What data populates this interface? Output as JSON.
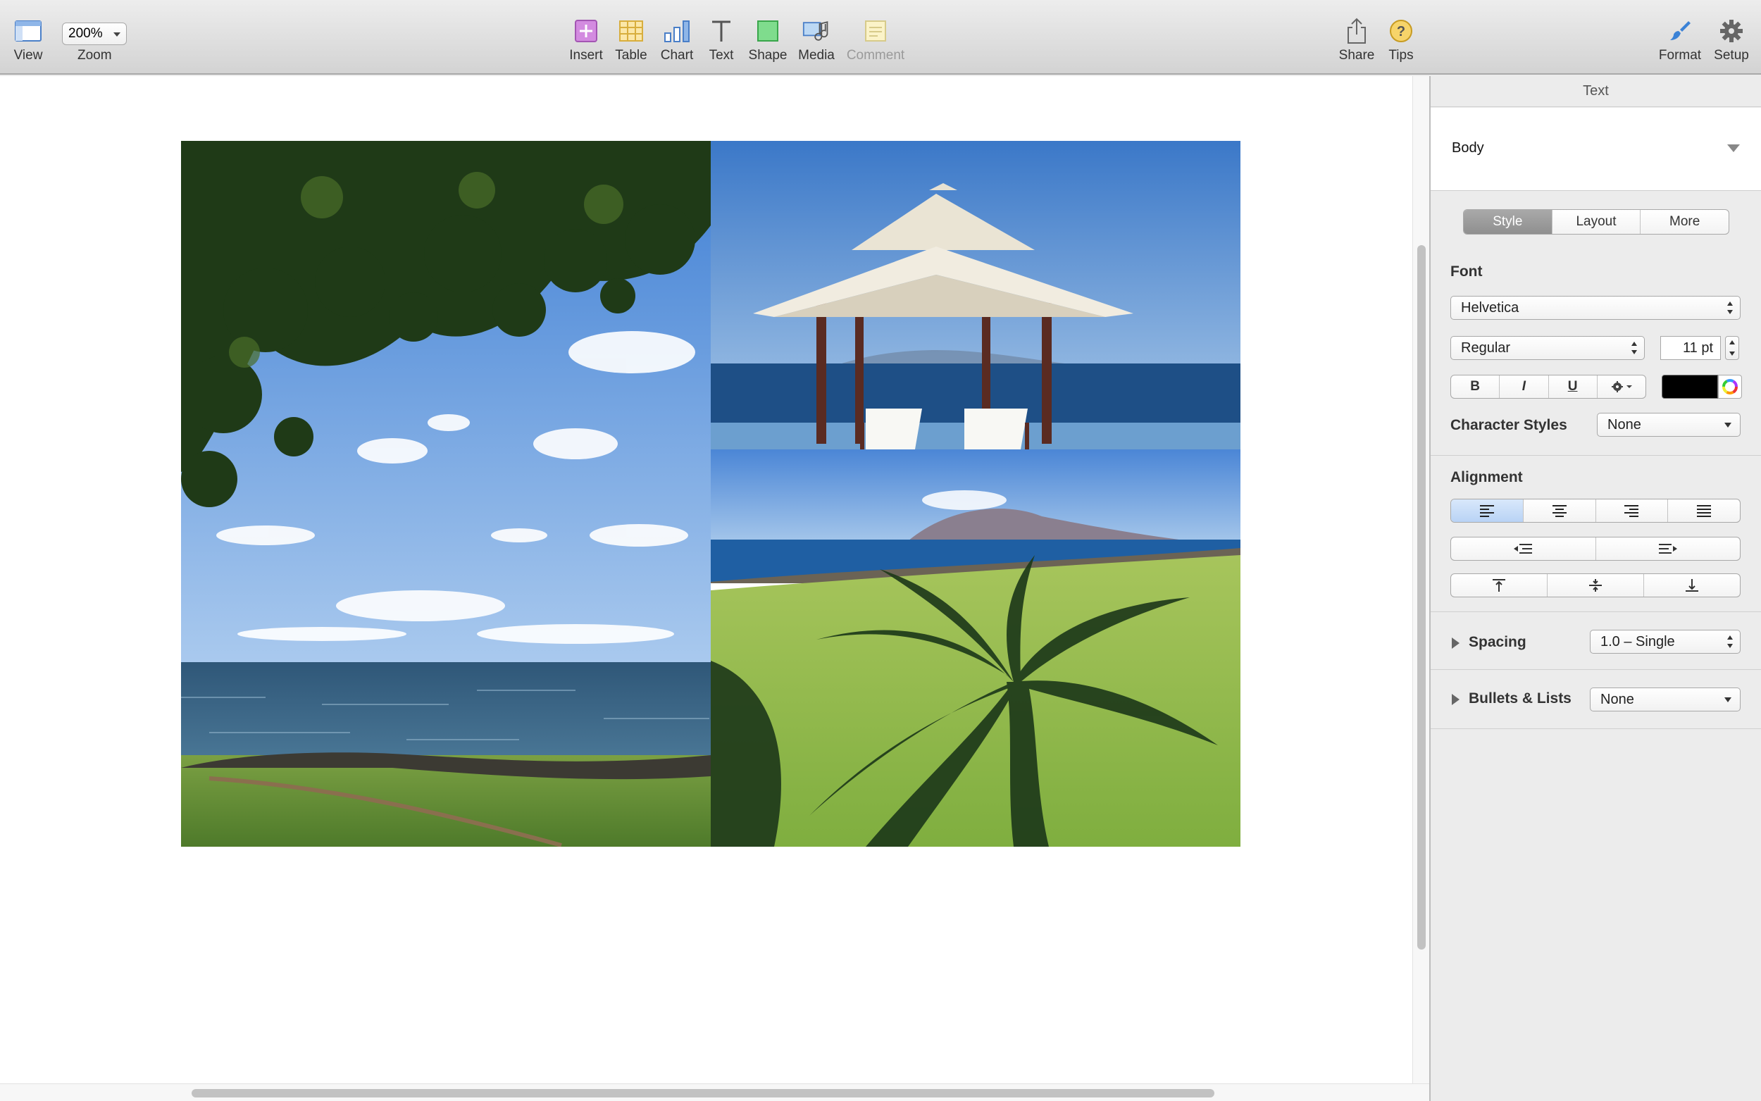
{
  "toolbar": {
    "view_label": "View",
    "zoom_value": "200%",
    "zoom_label": "Zoom",
    "insert_label": "Insert",
    "table_label": "Table",
    "chart_label": "Chart",
    "text_label": "Text",
    "shape_label": "Shape",
    "media_label": "Media",
    "comment_label": "Comment",
    "share_label": "Share",
    "tips_label": "Tips",
    "format_label": "Format",
    "setup_label": "Setup"
  },
  "sidebar": {
    "header": "Text",
    "paragraph_style": "Body",
    "tabs": [
      "Style",
      "Layout",
      "More"
    ],
    "font_title": "Font",
    "font_family": "Helvetica",
    "font_typeface": "Regular",
    "font_size": "11 pt",
    "bold": "B",
    "italic": "I",
    "underline": "U",
    "text_color": "#000000",
    "character_styles_title": "Character Styles",
    "character_styles_value": "None",
    "alignment_title": "Alignment",
    "spacing_title": "Spacing",
    "spacing_value": "1.0 – Single",
    "bullets_title": "Bullets & Lists",
    "bullets_value": "None"
  },
  "colors": {
    "accent_blue": "#3b82d6",
    "toolbar_bg": "#dedede",
    "sidebar_bg": "#ececec"
  }
}
